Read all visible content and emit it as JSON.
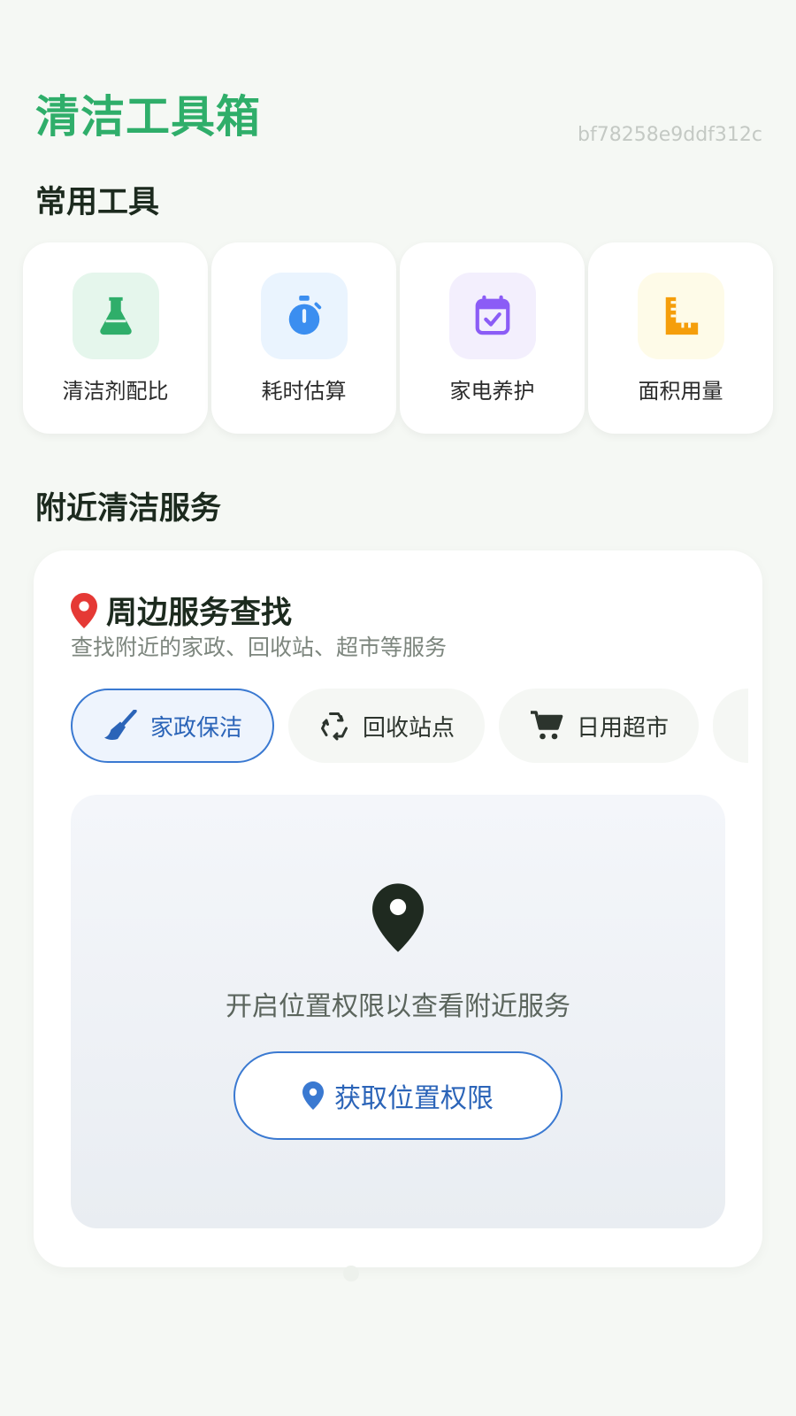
{
  "app": {
    "title": "清洁工具箱",
    "device_id": "bf78258e9ddf312c"
  },
  "tools_section": {
    "title": "常用工具",
    "items": [
      {
        "label": "清洁剂配比",
        "icon": "flask-icon",
        "color": "#2fae6a",
        "bg": "#e5f6ec"
      },
      {
        "label": "耗时估算",
        "icon": "stopwatch-icon",
        "color": "#3b8ef0",
        "bg": "#eaf4fe"
      },
      {
        "label": "家电养护",
        "icon": "calendar-check-icon",
        "color": "#8b5cf6",
        "bg": "#f3effd"
      },
      {
        "label": "面积用量",
        "icon": "ruler-icon",
        "color": "#f59e0b",
        "bg": "#fefbe8"
      }
    ]
  },
  "nearby_section": {
    "title": "附近清洁服务",
    "card": {
      "title": "周边服务查找",
      "subtitle": "查找附近的家政、回收站、超市等服务",
      "chips": [
        {
          "label": "家政保洁",
          "icon": "broom-icon",
          "active": true
        },
        {
          "label": "回收站点",
          "icon": "recycle-icon",
          "active": false
        },
        {
          "label": "日用超市",
          "icon": "cart-icon",
          "active": false
        }
      ],
      "map": {
        "message": "开启位置权限以查看附近服务",
        "button_label": "获取位置权限"
      }
    }
  },
  "colors": {
    "brand_green": "#2fae6a",
    "accent_blue": "#3a79d1",
    "pin_red": "#e53935",
    "pin_dark": "#1f2a20"
  }
}
